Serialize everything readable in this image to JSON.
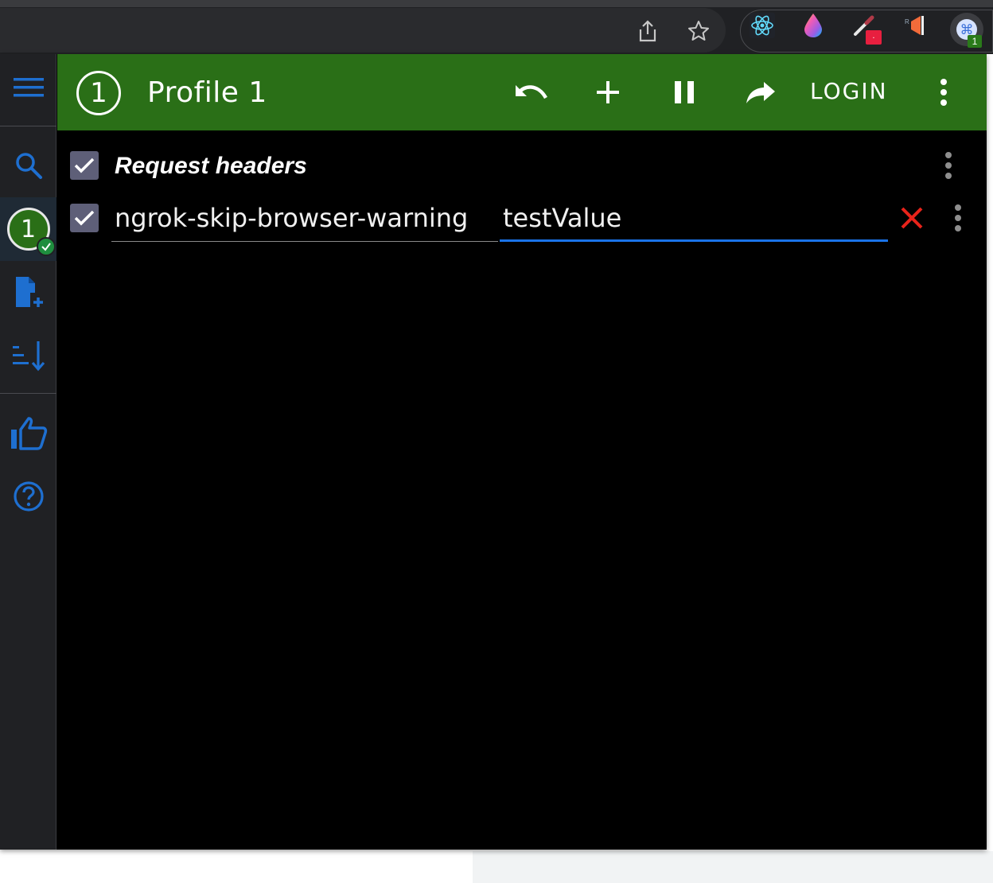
{
  "browser": {
    "extensions": [
      {
        "icon": "react-devtools-icon"
      },
      {
        "icon": "color-drop-icon"
      },
      {
        "icon": "eyedropper-icon",
        "badge": "."
      },
      {
        "icon": "megaphone-icon"
      },
      {
        "icon": "modheader-icon",
        "badge": "1"
      }
    ]
  },
  "sidebar": {
    "profile_number": "1"
  },
  "header": {
    "profile_number": "1",
    "title": "Profile 1",
    "login_label": "LOGIN"
  },
  "section": {
    "title": "Request headers",
    "enabled": true
  },
  "headers": [
    {
      "name": "ngrok-skip-browser-warning",
      "value": "testValue",
      "enabled": true
    }
  ],
  "colors": {
    "header_bg": "#2a6f17",
    "accent_blue": "#1a73e8",
    "delete_red": "#e8231a"
  }
}
